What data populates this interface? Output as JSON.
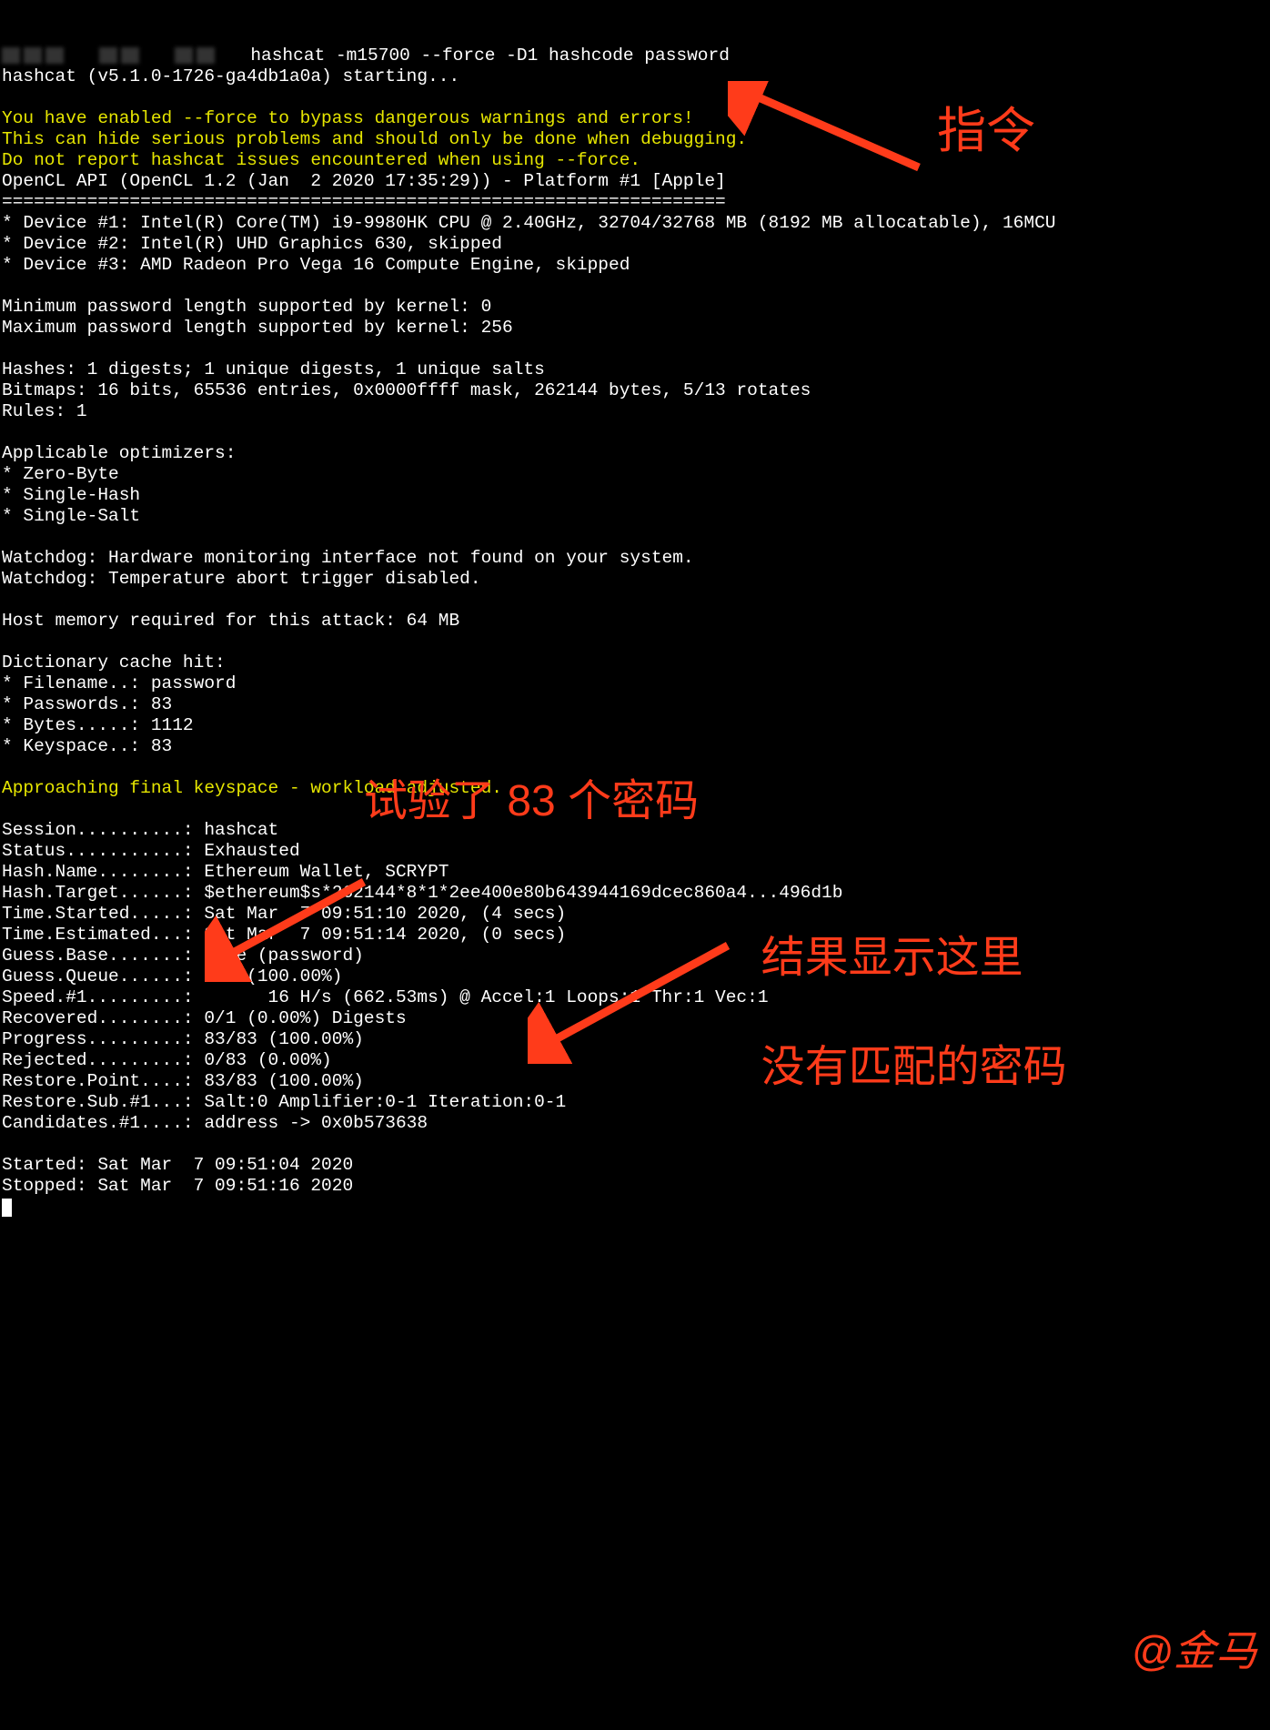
{
  "prompt": {
    "command": "hashcat -m15700 --force -D1 hashcode password"
  },
  "lines": {
    "starting": "hashcat (v5.1.0-1726-ga4db1a0a) starting...",
    "warn1": "You have enabled --force to bypass dangerous warnings and errors!",
    "warn2": "This can hide serious problems and should only be done when debugging.",
    "warn3": "Do not report hashcat issues encountered when using --force.",
    "opencl": "OpenCL API (OpenCL 1.2 (Jan  2 2020 17:35:29)) - Platform #1 [Apple]",
    "sep": "====================================================================",
    "dev1": "* Device #1: Intel(R) Core(TM) i9-9980HK CPU @ 2.40GHz, 32704/32768 MB (8192 MB allocatable), 16MCU",
    "dev2": "* Device #2: Intel(R) UHD Graphics 630, skipped",
    "dev3": "* Device #3: AMD Radeon Pro Vega 16 Compute Engine, skipped",
    "minpw": "Minimum password length supported by kernel: 0",
    "maxpw": "Maximum password length supported by kernel: 256",
    "hashes": "Hashes: 1 digests; 1 unique digests, 1 unique salts",
    "bitmaps": "Bitmaps: 16 bits, 65536 entries, 0x0000ffff mask, 262144 bytes, 5/13 rotates",
    "rules": "Rules: 1",
    "appopt": "Applicable optimizers:",
    "opt1": "* Zero-Byte",
    "opt2": "* Single-Hash",
    "opt3": "* Single-Salt",
    "wd1": "Watchdog: Hardware monitoring interface not found on your system.",
    "wd2": "Watchdog: Temperature abort trigger disabled.",
    "hostmem": "Host memory required for this attack: 64 MB",
    "dch": "Dictionary cache hit:",
    "fn": "* Filename..: password",
    "pw": "* Passwords.: 83",
    "bytes": "* Bytes.....: 1112",
    "ks": "* Keyspace..: 83",
    "approach": "Approaching final keyspace - workload adjusted.",
    "session": "Session..........: hashcat",
    "status": "Status...........: Exhausted",
    "hashname": "Hash.Name........: Ethereum Wallet, SCRYPT",
    "hashtgt": "Hash.Target......: $ethereum$s*262144*8*1*2ee400e80b643944169dcec860a4...496d1b",
    "tstart": "Time.Started.....: Sat Mar  7 09:51:10 2020, (4 secs)",
    "test": "Time.Estimated...: Sat Mar  7 09:51:14 2020, (0 secs)",
    "gbase": "Guess.Base.......: File (password)",
    "gqueue": "Guess.Queue......: 1/1 (100.00%)",
    "speed": "Speed.#1.........:       16 H/s (662.53ms) @ Accel:1 Loops:1 Thr:1 Vec:1",
    "recov": "Recovered........: 0/1 (0.00%) Digests",
    "prog": "Progress.........: 83/83 (100.00%)",
    "rej": "Rejected.........: 0/83 (0.00%)",
    "rpoint": "Restore.Point....: 83/83 (100.00%)",
    "rsub": "Restore.Sub.#1...: Salt:0 Amplifier:0-1 Iteration:0-1",
    "cand": "Candidates.#1....: address -> 0x0b573638",
    "started": "Started: Sat Mar  7 09:51:04 2020",
    "stopped": "Stopped: Sat Mar  7 09:51:16 2020"
  },
  "annotations": {
    "a1": "指令",
    "a2": "试验了 83 个密码",
    "a3_line1": "结果显示这里",
    "a3_line2": "没有匹配的密码",
    "watermark": "@金马"
  }
}
